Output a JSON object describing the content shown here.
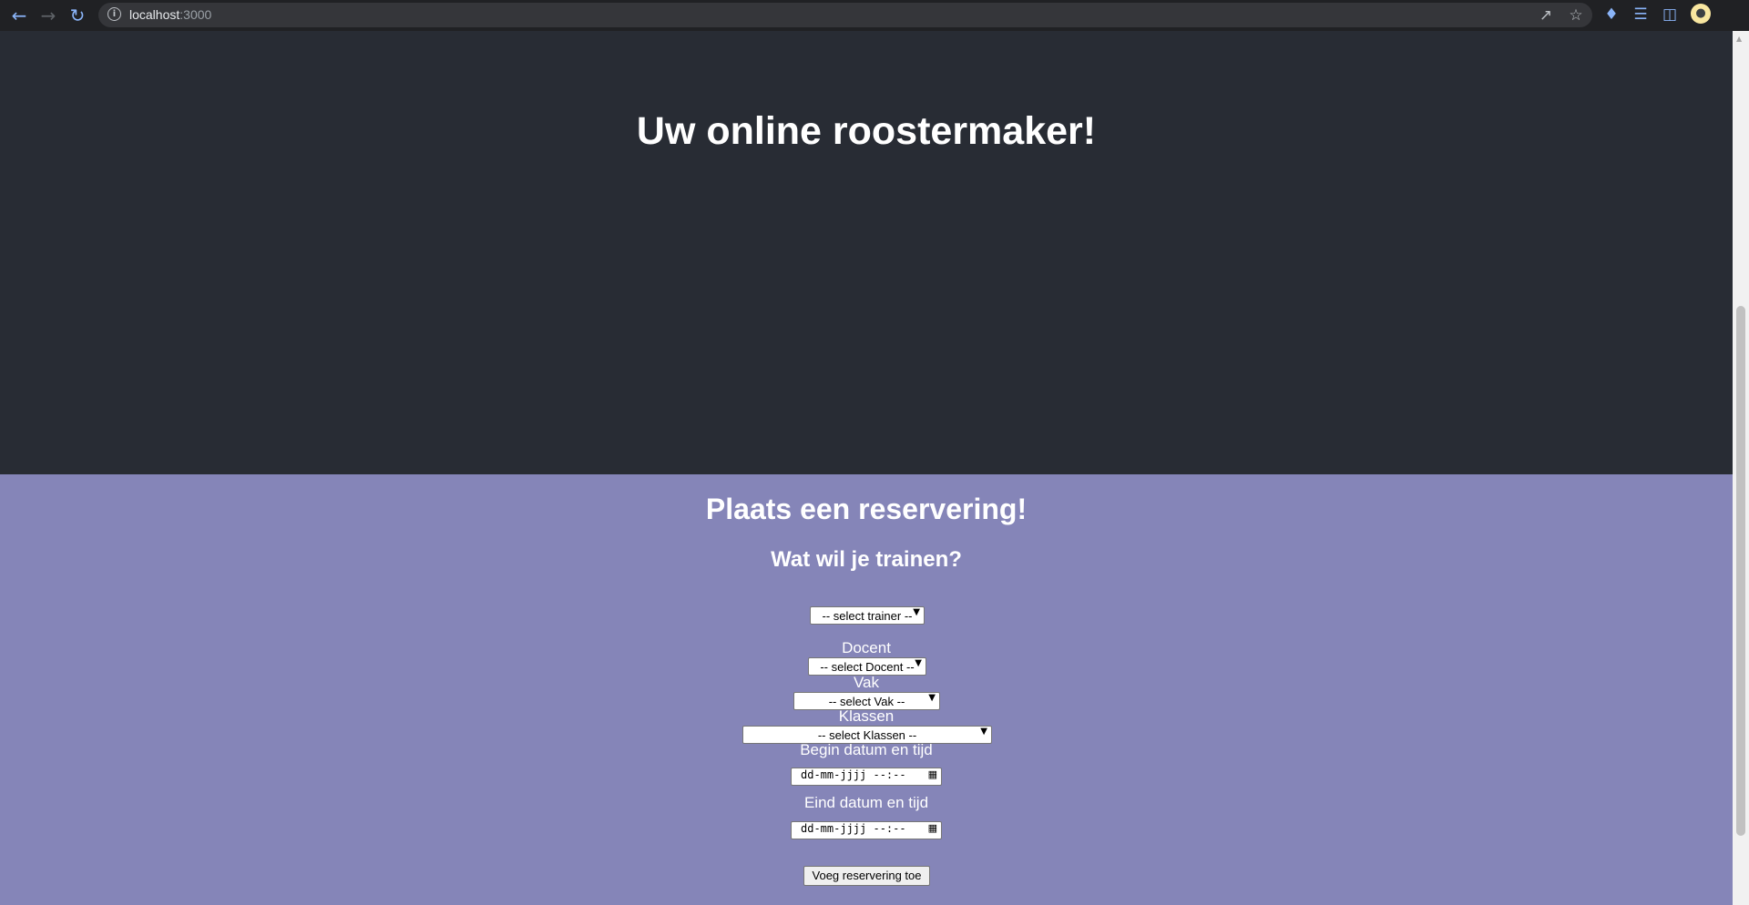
{
  "browser": {
    "url_host": "localhost",
    "url_port": ":3000",
    "icons": [
      "back-icon",
      "forward-icon",
      "reload-icon",
      "info-icon",
      "share-icon",
      "star-icon",
      "extensions-icon",
      "media-icon",
      "sidepanel-icon",
      "bulb-icon"
    ]
  },
  "header": {
    "title": "Uw online roostermaker!"
  },
  "form": {
    "title": "Plaats een reservering!",
    "subtitle": "Wat wil je trainen?",
    "trainer_select": "-- select trainer --",
    "docent_label": "Docent",
    "docent_select": "-- select Docent --",
    "vak_label": "Vak",
    "vak_select": "-- select Vak --",
    "klassen_label": "Klassen",
    "klassen_select": "-- select Klassen --",
    "begin_label": "Begin datum en tijd",
    "begin_value": "dd-mm-jjjj --:--",
    "eind_label": "Eind datum en tijd",
    "eind_value": "dd-mm-jjjj --:--",
    "submit_label": "Voeg reservering toe"
  },
  "colors": {
    "header_bg": "#282c34",
    "form_bg": "#8585b8"
  }
}
